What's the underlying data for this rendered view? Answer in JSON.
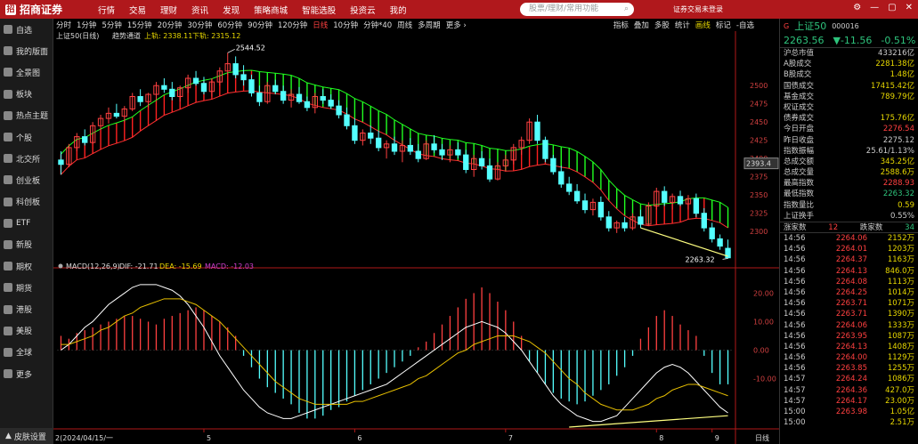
{
  "topbar": {
    "brand": "招商证券",
    "menu": [
      "行情",
      "交易",
      "理财",
      "资讯",
      "发现",
      "策略商城",
      "智能选股",
      "投资云",
      "我的"
    ],
    "search_placeholder": "股票/理财/常用功能",
    "login": "证券交易未登录",
    "controls": [
      "⚙",
      "—",
      "▢",
      "✕"
    ]
  },
  "sidebar": {
    "items": [
      "自选",
      "我的版面",
      "全景图",
      "板块",
      "热点主题",
      "个股",
      "北交所",
      "创业板",
      "科创板",
      "ETF",
      "新股",
      "期权",
      "期货",
      "港股",
      "美股",
      "全球",
      "更多"
    ],
    "skin": "皮肤设置"
  },
  "period_bar": {
    "items": [
      "分时",
      "1分钟",
      "5分钟",
      "15分钟",
      "20分钟",
      "30分钟",
      "60分钟",
      "90分钟",
      "120分钟",
      "日线",
      "10分钟",
      "分钟*40",
      "周线",
      "多周期",
      "更多 ›"
    ],
    "active": "日线",
    "right_items": [
      "指标",
      "叠加",
      "多股",
      "统计",
      "画线",
      "标记",
      "-自选"
    ],
    "right_active": "画线"
  },
  "chart_header": {
    "title": "上证50(日线)",
    "indicator": "趋势通道",
    "upper": "上轨: 2338.11",
    "lower": "下轨: 2315.12"
  },
  "macd_header": {
    "name": "MACD(12,26,9)",
    "dif": "DIF: -21.71",
    "dea": "DEA: -15.69",
    "macd": "MACD: -12.03"
  },
  "price_axis": [
    "2500",
    "2475",
    "2450",
    "2425",
    "2400",
    "2375",
    "2350",
    "2325",
    "2300"
  ],
  "current_price_tag": "2393.4",
  "macd_axis": [
    "20.00",
    "10.00",
    "0.00",
    "-10.00"
  ],
  "high_label": "2544.52",
  "low_label": "2263.32",
  "date_axis": {
    "first": "2(2024/04/15/一",
    "months": [
      "5",
      "6",
      "7",
      "8",
      "9"
    ],
    "cycle": "日线"
  },
  "right_panel": {
    "name": "上证50",
    "code": "000016",
    "price": "2263.56",
    "change": "▼-11.56",
    "pct": "-0.51%",
    "stats": [
      {
        "k": "沪总市值",
        "v": "433216亿",
        "c": ""
      },
      {
        "k": "A股成交",
        "v": "2281.38亿",
        "c": "yel"
      },
      {
        "k": "B股成交",
        "v": "1.48亿",
        "c": "yel"
      },
      {
        "k": "国债成交",
        "v": "17415.42亿",
        "c": "yel"
      },
      {
        "k": "基金成交",
        "v": "789.79亿",
        "c": "yel"
      },
      {
        "k": "权证成交",
        "v": "",
        "c": ""
      },
      {
        "k": "债券成交",
        "v": "175.76亿",
        "c": "yel"
      },
      {
        "k": "今日开盘",
        "v": "2276.54",
        "c": "red"
      },
      {
        "k": "昨日收盘",
        "v": "2275.12",
        "c": ""
      },
      {
        "k": "指数振幅",
        "v": "25.61/1.13%",
        "c": ""
      },
      {
        "k": "总成交额",
        "v": "345.25亿",
        "c": "yel"
      },
      {
        "k": "总成交量",
        "v": "2588.6万",
        "c": "yel"
      },
      {
        "k": "最高指数",
        "v": "2288.93",
        "c": "red"
      },
      {
        "k": "最低指数",
        "v": "2263.32",
        "c": "grn"
      },
      {
        "k": "指数量比",
        "v": "0.59",
        "c": "yel"
      },
      {
        "k": "上证换手",
        "v": "0.55%",
        "c": ""
      }
    ],
    "up_label": "涨家数",
    "up_count": "12",
    "down_label": "跌家数",
    "down_count": "34",
    "ticks": [
      {
        "t": "14:56",
        "p": "2264.06",
        "v": "2152万"
      },
      {
        "t": "14:56",
        "p": "2264.01",
        "v": "1203万"
      },
      {
        "t": "14:56",
        "p": "2264.37",
        "v": "1163万"
      },
      {
        "t": "14:56",
        "p": "2264.13",
        "v": "846.0万"
      },
      {
        "t": "14:56",
        "p": "2264.08",
        "v": "1113万"
      },
      {
        "t": "14:56",
        "p": "2264.25",
        "v": "1014万"
      },
      {
        "t": "14:56",
        "p": "2263.71",
        "v": "1071万"
      },
      {
        "t": "14:56",
        "p": "2263.71",
        "v": "1390万"
      },
      {
        "t": "14:56",
        "p": "2264.06",
        "v": "1333万"
      },
      {
        "t": "14:56",
        "p": "2263.95",
        "v": "1087万"
      },
      {
        "t": "14:56",
        "p": "2264.13",
        "v": "1408万"
      },
      {
        "t": "14:56",
        "p": "2264.00",
        "v": "1129万"
      },
      {
        "t": "14:56",
        "p": "2263.85",
        "v": "1255万"
      },
      {
        "t": "14:57",
        "p": "2264.24",
        "v": "1086万"
      },
      {
        "t": "14:57",
        "p": "2264.36",
        "v": "427.0万"
      },
      {
        "t": "14:57",
        "p": "2264.17",
        "v": "23.00万"
      },
      {
        "t": "15:00",
        "p": "2263.98",
        "v": "1.05亿"
      },
      {
        "t": "15:00",
        "p": "",
        "v": "2.51万"
      }
    ]
  },
  "colors": {
    "up": "#ff4040",
    "down": "#54ffff",
    "channel_up": "#ff2020",
    "channel_down": "#20ff20",
    "dif": "#ffffff",
    "dea": "#e8c000"
  },
  "chart_data": {
    "type": "candlestick",
    "ylim": [
      2260,
      2560
    ],
    "macd_ylim": [
      -27,
      27
    ],
    "candles": [
      [
        2398,
        2410,
        2378,
        2392
      ],
      [
        2392,
        2420,
        2388,
        2415
      ],
      [
        2415,
        2435,
        2410,
        2430
      ],
      [
        2430,
        2440,
        2418,
        2422
      ],
      [
        2422,
        2450,
        2420,
        2445
      ],
      [
        2445,
        2460,
        2440,
        2455
      ],
      [
        2455,
        2470,
        2448,
        2462
      ],
      [
        2462,
        2475,
        2455,
        2458
      ],
      [
        2458,
        2472,
        2450,
        2468
      ],
      [
        2468,
        2490,
        2465,
        2485
      ],
      [
        2485,
        2495,
        2472,
        2478
      ],
      [
        2478,
        2490,
        2470,
        2488
      ],
      [
        2488,
        2505,
        2480,
        2500
      ],
      [
        2500,
        2510,
        2490,
        2495
      ],
      [
        2495,
        2505,
        2480,
        2485
      ],
      [
        2485,
        2500,
        2478,
        2497
      ],
      [
        2497,
        2515,
        2490,
        2510
      ],
      [
        2510,
        2520,
        2500,
        2503
      ],
      [
        2503,
        2512,
        2488,
        2492
      ],
      [
        2492,
        2510,
        2485,
        2505
      ],
      [
        2505,
        2525,
        2500,
        2520
      ],
      [
        2520,
        2545,
        2515,
        2530
      ],
      [
        2530,
        2540,
        2510,
        2515
      ],
      [
        2515,
        2528,
        2500,
        2508
      ],
      [
        2508,
        2515,
        2485,
        2490
      ],
      [
        2490,
        2500,
        2472,
        2478
      ],
      [
        2478,
        2505,
        2475,
        2500
      ],
      [
        2500,
        2508,
        2488,
        2492
      ],
      [
        2492,
        2500,
        2475,
        2480
      ],
      [
        2480,
        2495,
        2470,
        2488
      ],
      [
        2488,
        2498,
        2475,
        2478
      ],
      [
        2478,
        2485,
        2465,
        2470
      ],
      [
        2470,
        2490,
        2462,
        2485
      ],
      [
        2485,
        2495,
        2475,
        2480
      ],
      [
        2480,
        2488,
        2468,
        2472
      ],
      [
        2472,
        2480,
        2455,
        2460
      ],
      [
        2460,
        2470,
        2440,
        2445
      ],
      [
        2445,
        2455,
        2420,
        2425
      ],
      [
        2425,
        2440,
        2418,
        2435
      ],
      [
        2435,
        2445,
        2420,
        2428
      ],
      [
        2428,
        2438,
        2410,
        2415
      ],
      [
        2415,
        2425,
        2400,
        2420
      ],
      [
        2420,
        2430,
        2405,
        2410
      ],
      [
        2410,
        2425,
        2395,
        2418
      ],
      [
        2418,
        2428,
        2405,
        2410
      ],
      [
        2410,
        2420,
        2395,
        2400
      ],
      [
        2400,
        2425,
        2398,
        2420
      ],
      [
        2420,
        2432,
        2408,
        2412
      ],
      [
        2412,
        2420,
        2398,
        2405
      ],
      [
        2405,
        2418,
        2395,
        2412
      ],
      [
        2412,
        2422,
        2400,
        2405
      ],
      [
        2405,
        2412,
        2380,
        2385
      ],
      [
        2385,
        2405,
        2375,
        2400
      ],
      [
        2400,
        2410,
        2385,
        2390
      ],
      [
        2390,
        2400,
        2368,
        2372
      ],
      [
        2372,
        2395,
        2370,
        2390
      ],
      [
        2390,
        2405,
        2382,
        2398
      ],
      [
        2398,
        2420,
        2392,
        2415
      ],
      [
        2415,
        2430,
        2405,
        2425
      ],
      [
        2425,
        2455,
        2420,
        2450
      ],
      [
        2450,
        2460,
        2420,
        2425
      ],
      [
        2425,
        2430,
        2395,
        2400
      ],
      [
        2400,
        2405,
        2378,
        2382
      ],
      [
        2382,
        2390,
        2360,
        2365
      ],
      [
        2365,
        2375,
        2350,
        2355
      ],
      [
        2355,
        2365,
        2338,
        2342
      ],
      [
        2342,
        2352,
        2325,
        2330
      ],
      [
        2330,
        2345,
        2322,
        2340
      ],
      [
        2340,
        2348,
        2315,
        2320
      ],
      [
        2320,
        2328,
        2300,
        2305
      ],
      [
        2305,
        2315,
        2298,
        2312
      ],
      [
        2312,
        2320,
        2300,
        2305
      ],
      [
        2305,
        2325,
        2302,
        2320
      ],
      [
        2320,
        2330,
        2305,
        2310
      ],
      [
        2310,
        2340,
        2308,
        2335
      ],
      [
        2335,
        2360,
        2330,
        2355
      ],
      [
        2355,
        2362,
        2335,
        2340
      ],
      [
        2340,
        2352,
        2330,
        2348
      ],
      [
        2348,
        2356,
        2335,
        2338
      ],
      [
        2338,
        2350,
        2330,
        2345
      ],
      [
        2345,
        2352,
        2320,
        2325
      ],
      [
        2325,
        2332,
        2300,
        2305
      ],
      [
        2305,
        2312,
        2285,
        2290
      ],
      [
        2290,
        2296,
        2275,
        2280
      ],
      [
        2277,
        2289,
        2263,
        2264
      ]
    ],
    "macd_hist": [
      5,
      4,
      6,
      7,
      8,
      9,
      10,
      11,
      12,
      12,
      11,
      10,
      9,
      11,
      12,
      13,
      14,
      15,
      14,
      12,
      10,
      8,
      5,
      -2,
      -6,
      -10,
      -13,
      -15,
      -17,
      -19,
      -22,
      -24,
      -24,
      -23,
      -21,
      -20,
      -18,
      -16,
      -14,
      -12,
      -10,
      -8,
      -6,
      -4,
      -2,
      1,
      3,
      6,
      9,
      12,
      15,
      18,
      20,
      22,
      20,
      17,
      14,
      10,
      5,
      -4,
      -8,
      -12,
      -15,
      -17,
      -18,
      -19,
      -18,
      -16,
      -14,
      -12,
      -9,
      -6,
      -2,
      4,
      8,
      12,
      14,
      12,
      9,
      7,
      5,
      -2,
      -8,
      -12,
      -12
    ],
    "dif": [
      0,
      2,
      5,
      8,
      10,
      13,
      16,
      18,
      20,
      22,
      23,
      23,
      23,
      22,
      21,
      19,
      16,
      12,
      8,
      3,
      -2,
      -6,
      -10,
      -14,
      -17,
      -20,
      -22,
      -23,
      -24,
      -24,
      -23,
      -22,
      -21,
      -20,
      -19,
      -18,
      -17,
      -16,
      -15,
      -14,
      -13,
      -12,
      -10,
      -8,
      -6,
      -4,
      -2,
      0,
      2,
      4,
      6,
      8,
      9,
      10,
      9,
      8,
      6,
      3,
      0,
      -4,
      -8,
      -12,
      -16,
      -19,
      -21,
      -23,
      -24,
      -25,
      -25,
      -24,
      -23,
      -20,
      -17,
      -14,
      -11,
      -8,
      -6,
      -5,
      -6,
      -8,
      -11,
      -14,
      -17,
      -20,
      -22
    ],
    "dea": [
      2,
      2,
      3,
      4,
      5,
      7,
      8,
      10,
      12,
      13,
      15,
      16,
      17,
      18,
      18,
      18,
      17,
      16,
      14,
      12,
      10,
      7,
      4,
      1,
      -2,
      -5,
      -8,
      -11,
      -13,
      -15,
      -17,
      -18,
      -19,
      -19,
      -19,
      -19,
      -19,
      -18,
      -18,
      -17,
      -16,
      -15,
      -14,
      -13,
      -12,
      -10,
      -9,
      -7,
      -5,
      -3,
      -1,
      0,
      2,
      3,
      4,
      5,
      5,
      5,
      4,
      3,
      1,
      -1,
      -4,
      -7,
      -10,
      -12,
      -15,
      -17,
      -19,
      -20,
      -21,
      -21,
      -21,
      -20,
      -19,
      -17,
      -16,
      -14,
      -13,
      -12,
      -12,
      -13,
      -14,
      -15,
      -16
    ]
  }
}
